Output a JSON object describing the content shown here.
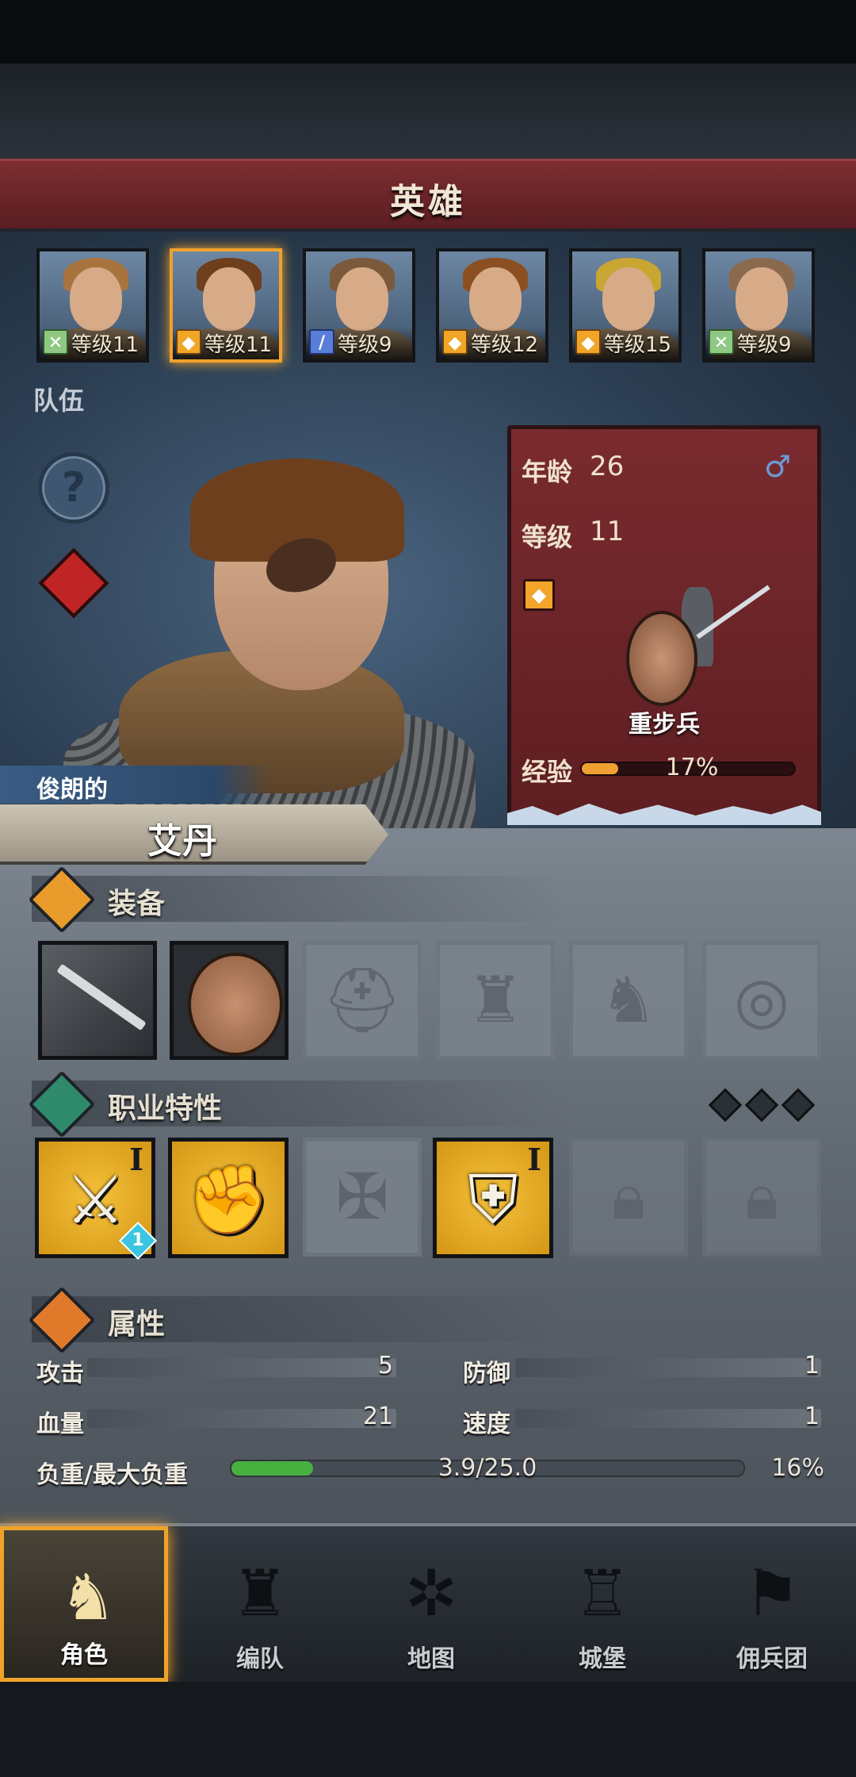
{
  "header": {
    "title": "英雄"
  },
  "heroes": [
    {
      "level_label": "等级11",
      "class": "ranger",
      "class_color": "#8fc882",
      "hair": "#a8743e",
      "selected": false
    },
    {
      "level_label": "等级11",
      "class": "shield",
      "class_color": "#f0a526",
      "hair": "#6d3f1c",
      "selected": true
    },
    {
      "level_label": "等级9",
      "class": "sword",
      "class_color": "#5a7ed8",
      "hair": "#7a5a3a",
      "selected": false
    },
    {
      "level_label": "等级12",
      "class": "shield",
      "class_color": "#f0a526",
      "hair": "#8c4f22",
      "selected": false
    },
    {
      "level_label": "等级15",
      "class": "shield",
      "class_color": "#f0a526",
      "hair": "#c9a532",
      "selected": false
    },
    {
      "level_label": "等级9",
      "class": "ranger",
      "class_color": "#8fc882",
      "hair": "#8a6a4e",
      "selected": false
    }
  ],
  "team": {
    "label": "队伍"
  },
  "stats": {
    "age_label": "年龄",
    "age_value": "26",
    "level_label": "等级",
    "level_value": "11",
    "gender_icon": "male-icon",
    "class_icon": "shield-class-icon",
    "unit_name": "重步兵",
    "exp_label": "经验",
    "exp_percent": "17%",
    "exp_fraction": 0.17
  },
  "hero": {
    "adjective": "俊朗的",
    "name": "艾丹"
  },
  "equipment": {
    "title": "装备",
    "slots": [
      {
        "icon": "spear-icon",
        "filled": true
      },
      {
        "icon": "round-shield-icon",
        "filled": true
      },
      {
        "icon": "helmet-icon",
        "filled": false
      },
      {
        "icon": "armor-icon",
        "filled": false
      },
      {
        "icon": "boots-icon",
        "filled": false
      },
      {
        "icon": "ring-icon",
        "filled": false
      }
    ]
  },
  "traits": {
    "title": "职业特性",
    "slots": [
      {
        "icon": "sword-break-icon",
        "tier": "I",
        "badge": "1",
        "state": "active"
      },
      {
        "icon": "gauntlet-icon",
        "tier": "",
        "badge": "",
        "state": "active"
      },
      {
        "icon": "cross-icon",
        "tier": "",
        "badge": "",
        "state": "empty"
      },
      {
        "icon": "shield-trait-icon",
        "tier": "I",
        "badge": "",
        "state": "active"
      },
      {
        "icon": "lock-icon",
        "tier": "",
        "badge": "",
        "state": "locked"
      },
      {
        "icon": "lock-icon",
        "tier": "",
        "badge": "",
        "state": "locked"
      }
    ]
  },
  "attributes": {
    "title": "属性",
    "attack_label": "攻击",
    "attack_value": "5",
    "defense_label": "防御",
    "defense_value": "1",
    "hp_label": "血量",
    "hp_value": "21",
    "speed_label": "速度",
    "speed_value": "1",
    "load_label": "负重/最大负重",
    "load_value": "3.9/25.0",
    "load_percent": "16%",
    "load_fraction": 0.16
  },
  "nav": [
    {
      "label": "角色",
      "icon": "knight-icon",
      "active": true
    },
    {
      "label": "编队",
      "icon": "helmet-squad-icon",
      "active": false
    },
    {
      "label": "地图",
      "icon": "compass-icon",
      "active": false
    },
    {
      "label": "城堡",
      "icon": "castle-icon",
      "active": false
    },
    {
      "label": "佣兵团",
      "icon": "banner-icon",
      "active": false
    }
  ]
}
